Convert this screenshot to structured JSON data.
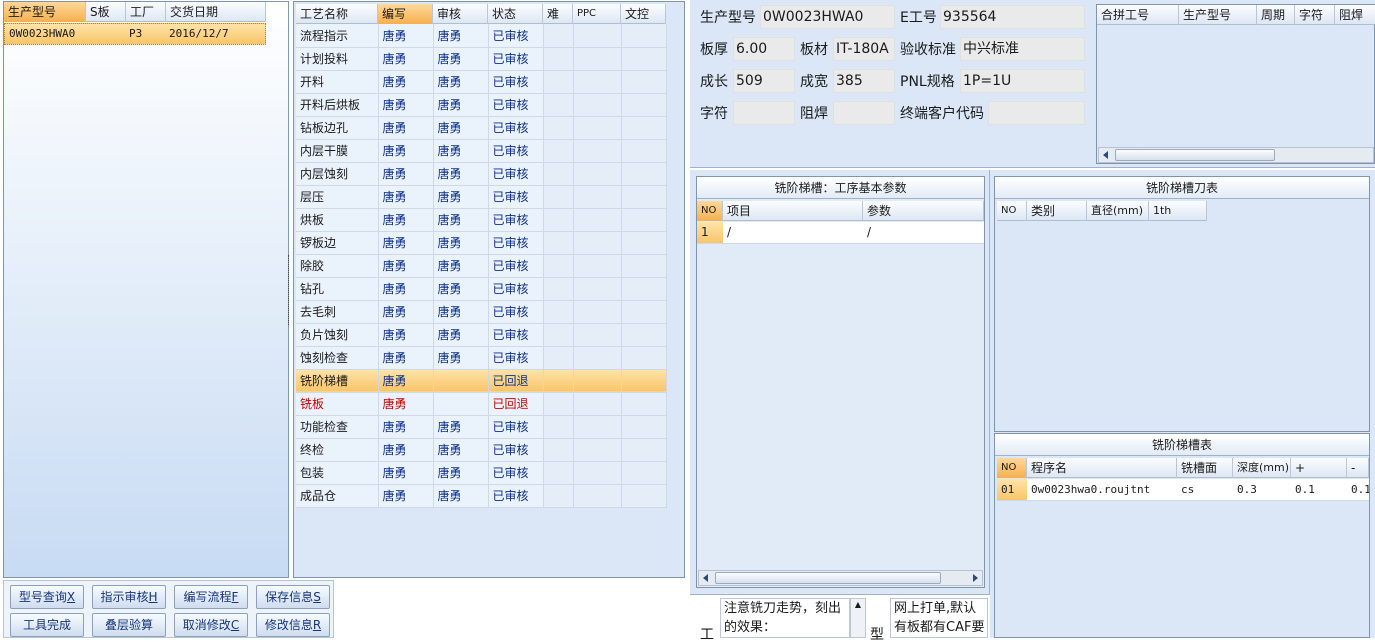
{
  "left_list": {
    "headers": [
      "生产型号",
      "S板",
      "工厂",
      "交货日期"
    ],
    "rows": [
      [
        "0W0023HWA0",
        "",
        "P3",
        "2016/12/7"
      ]
    ]
  },
  "process": {
    "headers": [
      "工艺名称",
      "编写",
      "审核",
      "状态",
      "难",
      "PPC",
      "文控"
    ],
    "rows": [
      [
        "流程指示",
        "唐勇",
        "唐勇",
        "已审核"
      ],
      [
        "计划投料",
        "唐勇",
        "唐勇",
        "已审核"
      ],
      [
        "开料",
        "唐勇",
        "唐勇",
        "已审核"
      ],
      [
        "开料后烘板",
        "唐勇",
        "唐勇",
        "已审核"
      ],
      [
        "钻板边孔",
        "唐勇",
        "唐勇",
        "已审核"
      ],
      [
        "内层干膜",
        "唐勇",
        "唐勇",
        "已审核"
      ],
      [
        "内层蚀刻",
        "唐勇",
        "唐勇",
        "已审核"
      ],
      [
        "层压",
        "唐勇",
        "唐勇",
        "已审核"
      ],
      [
        "烘板",
        "唐勇",
        "唐勇",
        "已审核"
      ],
      [
        "锣板边",
        "唐勇",
        "唐勇",
        "已审核"
      ],
      [
        "除胶",
        "唐勇",
        "唐勇",
        "已审核"
      ],
      [
        "钻孔",
        "唐勇",
        "唐勇",
        "已审核"
      ],
      [
        "去毛刺",
        "唐勇",
        "唐勇",
        "已审核"
      ],
      [
        "负片蚀刻",
        "唐勇",
        "唐勇",
        "已审核"
      ],
      [
        "蚀刻检查",
        "唐勇",
        "唐勇",
        "已审核"
      ],
      [
        "铣阶梯槽",
        "唐勇",
        "",
        "已回退"
      ],
      [
        "铣板",
        "唐勇",
        "",
        "已回退"
      ],
      [
        "功能检查",
        "唐勇",
        "唐勇",
        "已审核"
      ],
      [
        "终检",
        "唐勇",
        "唐勇",
        "已审核"
      ],
      [
        "包装",
        "唐勇",
        "唐勇",
        "已审核"
      ],
      [
        "成品仓",
        "唐勇",
        "唐勇",
        "已审核"
      ]
    ]
  },
  "buttons": {
    "query": "型号查询",
    "query_key": "X",
    "review": "指示审核",
    "review_key": "H",
    "write_flow": "编写流程",
    "write_flow_key": "F",
    "save": "保存信息",
    "save_key": "S",
    "tool_done": "工具完成",
    "stack_check": "叠层验算",
    "cancel_edit": "取消修改",
    "cancel_edit_key": "C",
    "edit_info": "修改信息",
    "edit_info_key": "R"
  },
  "info": {
    "model_label": "生产型号",
    "model": "0W0023HWA0",
    "e_label": "E工号",
    "e_value": "935564",
    "thickness_label": "板厚",
    "thickness": "6.00",
    "material_label": "板材",
    "material": "IT-180A",
    "standard_label": "验收标准",
    "standard": "中兴标准",
    "length_label": "成长",
    "length": "509",
    "width_label": "成宽",
    "width": "385",
    "pnl_label": "PNL规格",
    "pnl": "1P=1U",
    "char_label": "字符",
    "char": "",
    "solder_label": "阻焊",
    "solder": "",
    "customer_label": "终端客户代码",
    "customer": ""
  },
  "merge": {
    "headers": [
      "合拼工号",
      "生产型号",
      "周期",
      "字符",
      "阻焊"
    ]
  },
  "step_params": {
    "title": "铣阶梯槽：工序基本参数",
    "headers": [
      "NO",
      "项目",
      "参数"
    ],
    "rows": [
      [
        "1",
        "/",
        "/"
      ]
    ]
  },
  "cutter": {
    "title": "铣阶梯槽刀表",
    "headers": [
      "NO",
      "类别",
      "直径(mm)",
      "1th"
    ]
  },
  "step_table": {
    "title": "铣阶梯槽表",
    "headers": [
      "NO",
      "程序名",
      "铣槽面",
      "深度(mm)",
      "+",
      "-"
    ],
    "rows": [
      [
        "01",
        "0w0023hwa0.roujtnt",
        "cs",
        "0.3",
        "0.1",
        "0.1"
      ]
    ]
  },
  "notes": {
    "left_label": "工",
    "left_text": "注意铣刀走势，刻出的效果：",
    "right_label": "型",
    "right_text": "网上打单,默认有板都有CAF要"
  }
}
